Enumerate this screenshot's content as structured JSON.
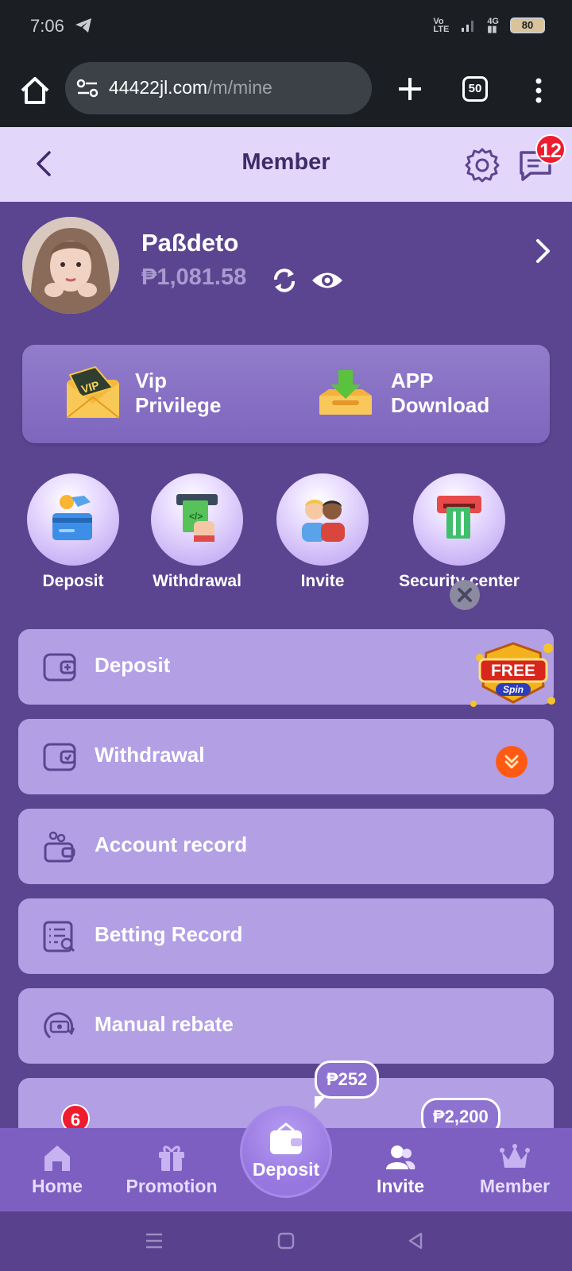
{
  "status_bar": {
    "time": "7:06",
    "battery": "80"
  },
  "browser": {
    "url_domain": "44422jl.com",
    "url_path": "/m/mine",
    "tab_count": "50"
  },
  "header": {
    "title": "Member",
    "message_badge": "12"
  },
  "profile": {
    "username": "Paßdeto",
    "balance": "₱1,081.58"
  },
  "promo": {
    "vip_label": "Vip\nPrivilege",
    "app_label": "APP\nDownload"
  },
  "quick_actions": [
    {
      "label": "Deposit",
      "icon": "deposit-hand-card-icon"
    },
    {
      "label": "Withdrawal",
      "icon": "withdrawal-atm-cash-icon"
    },
    {
      "label": "Invite",
      "icon": "invite-friends-icon"
    },
    {
      "label": "Security center",
      "icon": "security-atm-card-icon"
    }
  ],
  "menu": [
    {
      "label": "Deposit",
      "icon": "wallet-plus-icon"
    },
    {
      "label": "Withdrawal",
      "icon": "wallet-check-icon"
    },
    {
      "label": "Account record",
      "icon": "wallet-coins-icon"
    },
    {
      "label": "Betting Record",
      "icon": "list-search-icon"
    },
    {
      "label": "Manual rebate",
      "icon": "cash-rebate-icon"
    }
  ],
  "float": {
    "free_spin_text_1": "FREE",
    "free_spin_text_2": "Spin"
  },
  "chips": {
    "deposit_bonus": "₱252",
    "invite_bonus": "₱2,200",
    "menu_badge": "6"
  },
  "bottom_nav": [
    {
      "label": "Home"
    },
    {
      "label": "Promotion"
    },
    {
      "label": "Deposit"
    },
    {
      "label": "Invite"
    },
    {
      "label": "Member"
    }
  ],
  "colors": {
    "accent": "#5b4590",
    "header_bg": "#e3d6fb",
    "menu_bg": "#b29fe4",
    "badge": "#ee1c2e"
  }
}
